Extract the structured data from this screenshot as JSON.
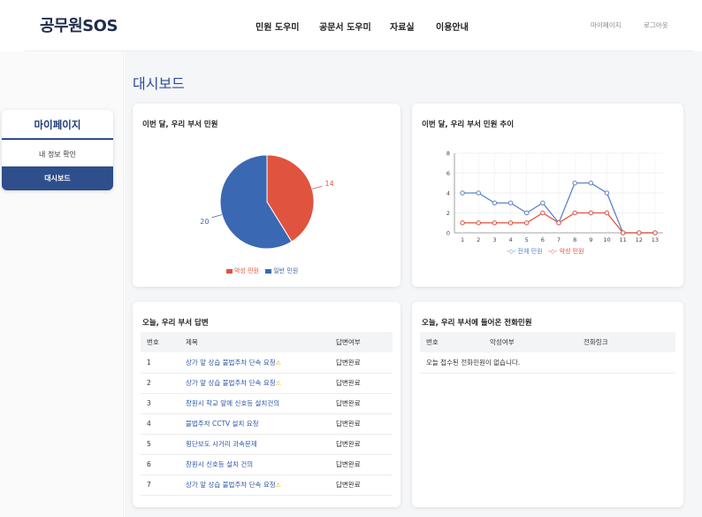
{
  "header": {
    "logo": "공무원SOS",
    "nav": [
      "민원 도우미",
      "공문서 도우미",
      "자료실",
      "이용안내"
    ],
    "util": [
      "마이페이지",
      "로그아웃"
    ]
  },
  "sidebar": {
    "title": "마이페이지",
    "items": [
      {
        "label": "내 정보 확인",
        "active": false
      },
      {
        "label": "대시보드",
        "active": true
      }
    ]
  },
  "main": {
    "title": "대시보드"
  },
  "pie_card": {
    "title": "이번 달, 우리 부서 민원",
    "legend": [
      "악성 민원",
      "일반 민원"
    ]
  },
  "line_card": {
    "title": "이번 달, 우리 부서 민원 추이",
    "legend": [
      "전체 민원",
      "악성 민원"
    ]
  },
  "reply_card": {
    "title": "오늘, 우리 부서 답변",
    "columns": [
      "번호",
      "제목",
      "답변여부"
    ],
    "rows": [
      {
        "no": "1",
        "title": "상가 앞 상습 불법주차 단속 요청",
        "warn": true,
        "status": "답변완료"
      },
      {
        "no": "2",
        "title": "상가 앞 상습 불법주차 단속 요청",
        "warn": true,
        "status": "답변완료"
      },
      {
        "no": "3",
        "title": "창원시 학교 앞에 신호등 설치건의",
        "warn": false,
        "status": "답변완료"
      },
      {
        "no": "4",
        "title": "불법주차 CCTV 설치 요청",
        "warn": false,
        "status": "답변완료"
      },
      {
        "no": "5",
        "title": "횡단보도 시거리 과속문제",
        "warn": false,
        "status": "답변완료"
      },
      {
        "no": "6",
        "title": "창원시 신호등 설치 건의",
        "warn": false,
        "status": "답변완료"
      },
      {
        "no": "7",
        "title": "상가 앞 상습 불법주차 단속 요청",
        "warn": true,
        "status": "답변완료"
      }
    ]
  },
  "call_card": {
    "title": "오늘, 우리 부서에 들어온 전화민원",
    "columns": [
      "번호",
      "악성여부",
      "전화링크"
    ],
    "empty": "오늘 접수된 전화민원이 없습니다."
  },
  "colors": {
    "accent": "#2e4e8c",
    "malicious": "#e0533f",
    "normal": "#3b68b2"
  },
  "chart_data": [
    {
      "type": "pie",
      "labels": [
        "악성 민원",
        "일반 민원"
      ],
      "values": [
        14,
        20
      ],
      "colors": [
        "#e0533f",
        "#3b68b2"
      ],
      "legend": "bottom"
    },
    {
      "type": "line",
      "x": [
        1,
        2,
        3,
        4,
        5,
        6,
        7,
        8,
        9,
        10,
        11,
        12,
        13
      ],
      "ylim": [
        0,
        8
      ],
      "yticks": [
        0,
        2,
        4,
        6,
        8
      ],
      "grid": true,
      "legend": "bottom",
      "series": [
        {
          "name": "전체 민원",
          "color": "#5b82c6",
          "values": [
            4,
            4,
            3,
            3,
            2,
            3,
            1,
            5,
            5,
            4,
            0,
            0,
            0
          ]
        },
        {
          "name": "악성 민원",
          "color": "#e0533f",
          "values": [
            1,
            1,
            1,
            1,
            1,
            2,
            1,
            2,
            2,
            2,
            0,
            0,
            0
          ]
        }
      ]
    }
  ]
}
